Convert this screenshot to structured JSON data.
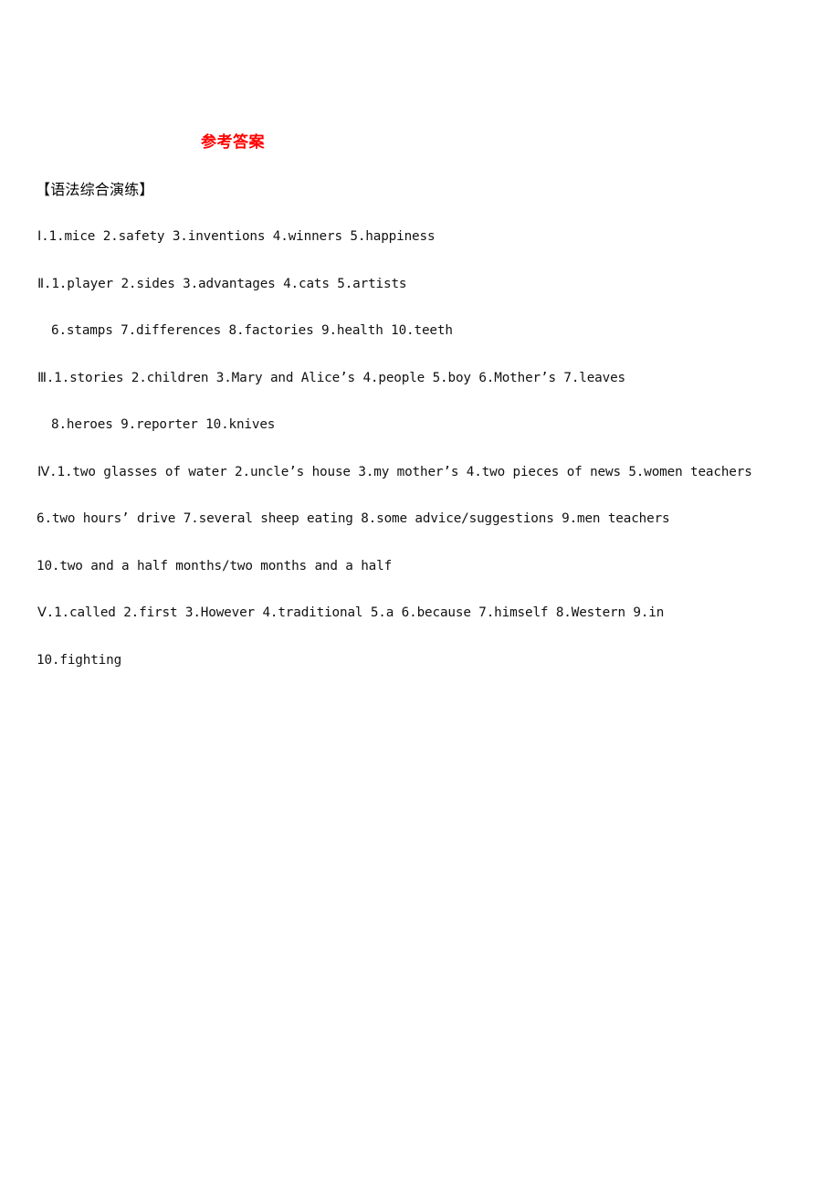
{
  "document": {
    "title": "参考答案",
    "title_color": "#FF0000",
    "section_heading": "【语法综合演练】",
    "body_color": "#111111",
    "background": "#FFFFFF"
  },
  "answers": {
    "lines": [
      {
        "id": "line-1",
        "indent": "ind-0",
        "text": "Ⅰ.1.mice  2.safety  3.inventions  4.winners  5.happiness"
      },
      {
        "id": "line-2",
        "indent": "ind-0",
        "text": "Ⅱ.1.player  2.sides  3.advantages  4.cats  5.artists"
      },
      {
        "id": "line-3",
        "indent": "ind-1",
        "text": "6.stamps  7.differences  8.factories  9.health  10.teeth"
      },
      {
        "id": "line-4",
        "indent": "ind-0",
        "text": "Ⅲ.1.stories  2.children  3.Mary and Alice’s  4.people  5.boy  6.Mother’s  7.leaves"
      },
      {
        "id": "line-5",
        "indent": "ind-1",
        "text": "8.heroes  9.reporter  10.knives"
      },
      {
        "id": "line-6",
        "indent": "ind-0",
        "text": "Ⅳ.1.two glasses of water  2.uncle’s house  3.my mother’s  4.two pieces of news  5.women teachers"
      },
      {
        "id": "line-7",
        "indent": "ind-2",
        "text": "6.two hours’ drive  7.several sheep eating  8.some advice/suggestions  9.men teachers"
      },
      {
        "id": "line-8",
        "indent": "ind-2",
        "text": "10.two and a half months/two months and a half"
      },
      {
        "id": "line-9",
        "indent": "ind-0",
        "text": "Ⅴ.1.called   2.first   3.However   4.traditional   5.a   6.because   7.himself   8.Western   9.in"
      },
      {
        "id": "line-10",
        "indent": "ind-2",
        "text": "10.fighting"
      }
    ],
    "sections": [
      {
        "numeral": "Ⅰ",
        "items": [
          "mice",
          "safety",
          "inventions",
          "winners",
          "happiness"
        ]
      },
      {
        "numeral": "Ⅱ",
        "items": [
          "player",
          "sides",
          "advantages",
          "cats",
          "artists",
          "stamps",
          "differences",
          "factories",
          "health",
          "teeth"
        ]
      },
      {
        "numeral": "Ⅲ",
        "items": [
          "stories",
          "children",
          "Mary and Alice’s",
          "people",
          "boy",
          "Mother’s",
          "leaves",
          "heroes",
          "reporter",
          "knives"
        ]
      },
      {
        "numeral": "Ⅳ",
        "items": [
          "two glasses of water",
          "uncle’s house",
          "my mother’s",
          "two pieces of news",
          "women teachers",
          "two hours’ drive",
          "several sheep eating",
          "some advice/suggestions",
          "men teachers",
          "two and a half months/two months and a half"
        ]
      },
      {
        "numeral": "Ⅴ",
        "items": [
          "called",
          "first",
          "However",
          "traditional",
          "a",
          "because",
          "himself",
          "Western",
          "in",
          "fighting"
        ]
      }
    ]
  }
}
